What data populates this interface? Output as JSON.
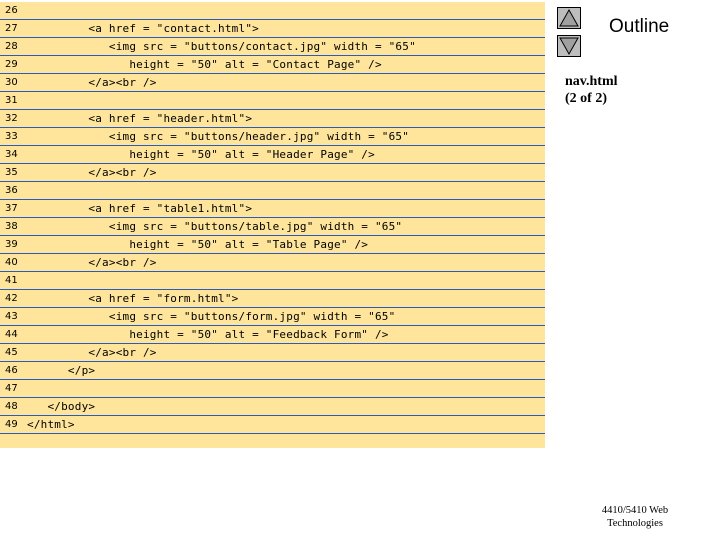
{
  "sidebar": {
    "outline_label": "Outline",
    "file_title_line1": "nav.html",
    "file_title_line2": "(2 of 2)",
    "up_icon": "triangle-up-icon",
    "down_icon": "triangle-down-icon"
  },
  "footer": {
    "line1": "4410/5410 Web",
    "line2": "Technologies"
  },
  "code": {
    "lines": [
      {
        "n": "26",
        "text": ""
      },
      {
        "n": "27",
        "text": "         <a href = \"contact.html\">"
      },
      {
        "n": "28",
        "text": "            <img src = \"buttons/contact.jpg\" width = \"65\""
      },
      {
        "n": "29",
        "text": "               height = \"50\" alt = \"Contact Page\" />"
      },
      {
        "n": "30",
        "text": "         </a><br />"
      },
      {
        "n": "31",
        "text": ""
      },
      {
        "n": "32",
        "text": "         <a href = \"header.html\">"
      },
      {
        "n": "33",
        "text": "            <img src = \"buttons/header.jpg\" width = \"65\""
      },
      {
        "n": "34",
        "text": "               height = \"50\" alt = \"Header Page\" />"
      },
      {
        "n": "35",
        "text": "         </a><br />"
      },
      {
        "n": "36",
        "text": ""
      },
      {
        "n": "37",
        "text": "         <a href = \"table1.html\">"
      },
      {
        "n": "38",
        "text": "            <img src = \"buttons/table.jpg\" width = \"65\""
      },
      {
        "n": "39",
        "text": "               height = \"50\" alt = \"Table Page\" />"
      },
      {
        "n": "40",
        "text": "         </a><br />"
      },
      {
        "n": "41",
        "text": ""
      },
      {
        "n": "42",
        "text": "         <a href = \"form.html\">"
      },
      {
        "n": "43",
        "text": "            <img src = \"buttons/form.jpg\" width = \"65\""
      },
      {
        "n": "44",
        "text": "               height = \"50\" alt = \"Feedback Form\" />"
      },
      {
        "n": "45",
        "text": "         </a><br />"
      },
      {
        "n": "46",
        "text": "      </p>"
      },
      {
        "n": "47",
        "text": ""
      },
      {
        "n": "48",
        "text": "   </body>"
      },
      {
        "n": "49",
        "text": "</html>"
      }
    ]
  },
  "colors": {
    "code_background": "#fee59b",
    "separator": "#2b5db8",
    "button_fill": "#bdbdbd"
  }
}
